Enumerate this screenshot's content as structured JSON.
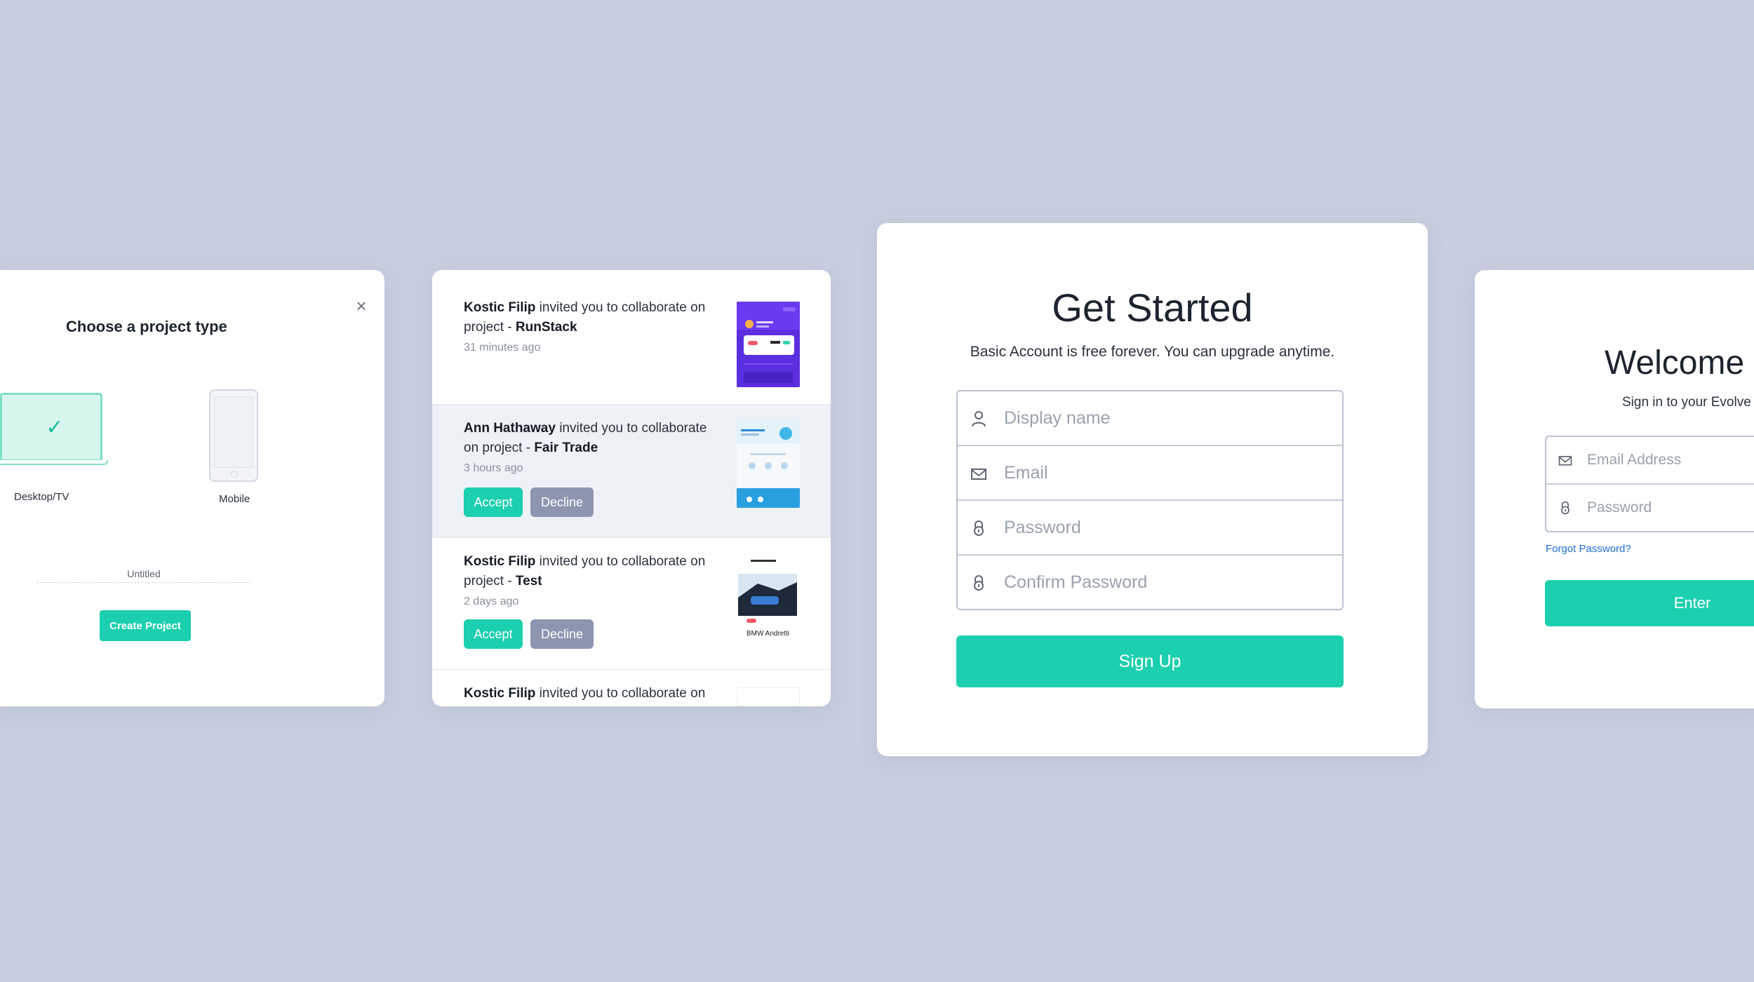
{
  "project_card": {
    "close_icon": "close-icon",
    "title": "Choose a project type",
    "options": [
      {
        "label": "Desktop/TV",
        "selected": true,
        "icon": "desktop-icon"
      },
      {
        "label": "Mobile",
        "selected": false,
        "icon": "mobile-icon"
      }
    ],
    "name_value": "Untitled",
    "create_label": "Create Project"
  },
  "notifications": [
    {
      "user": "Kostic Filip",
      "message": " invited you to collaborate on project - ",
      "project": "RunStack",
      "time": "31 minutes ago",
      "actions": false
    },
    {
      "user": "Ann Hathaway",
      "message": " invited you to collaborate on project - ",
      "project": "Fair Trade",
      "time": "3 hours ago",
      "actions": true
    },
    {
      "user": "Kostic Filip",
      "message": " invited you to collaborate on project - ",
      "project": "Test",
      "time": "2 days ago",
      "actions": true
    },
    {
      "user": "Kostic Filip",
      "message": " invited you to collaborate on",
      "project": "",
      "time": "",
      "actions": false
    }
  ],
  "notif_actions": {
    "accept": "Accept",
    "decline": "Decline"
  },
  "thumb_texts": {
    "bmw": "BMW Andretti"
  },
  "signup": {
    "title": "Get Started",
    "subtitle": "Basic Account is free forever. You can upgrade anytime.",
    "fields": [
      {
        "placeholder": "Display name",
        "icon": "user-icon"
      },
      {
        "placeholder": "Email",
        "icon": "mail-icon"
      },
      {
        "placeholder": "Password",
        "icon": "lock-icon"
      },
      {
        "placeholder": "Confirm Password",
        "icon": "lock-icon"
      }
    ],
    "button": "Sign Up"
  },
  "welcome": {
    "title": "Welcome",
    "subtitle": "Sign in to your Evolve",
    "fields": [
      {
        "placeholder": "Email Address",
        "icon": "mail-icon"
      },
      {
        "placeholder": "Password",
        "icon": "lock-icon"
      }
    ],
    "forgot": "Forgot Password?",
    "button": "Enter"
  },
  "colors": {
    "accent": "#1ccfae",
    "background": "#c8cedf",
    "decline": "#8e95b1",
    "link": "#1e6fd9"
  }
}
